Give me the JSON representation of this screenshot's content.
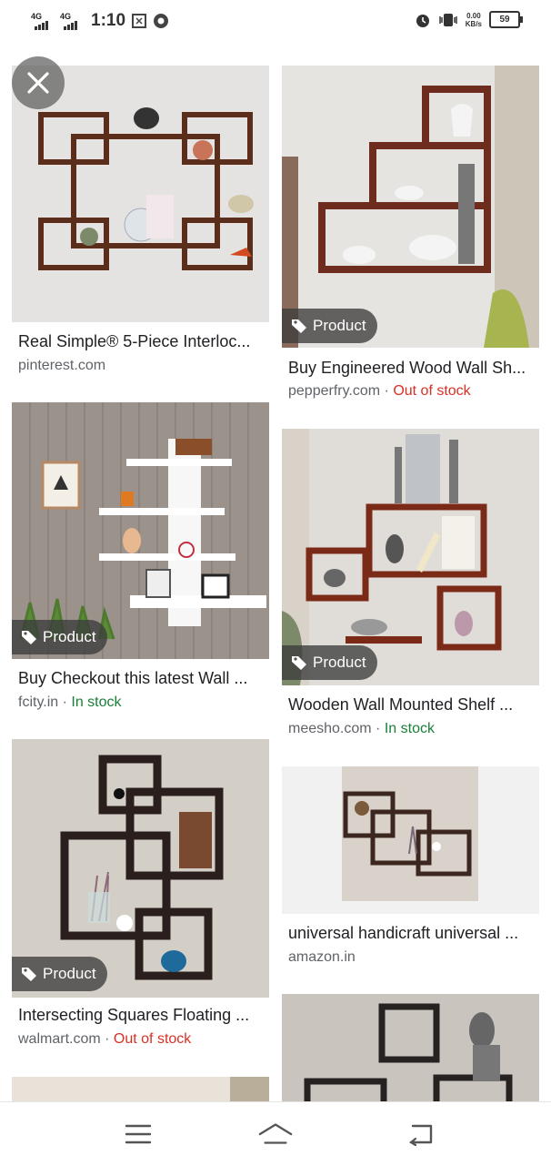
{
  "status_bar": {
    "network1": "4G",
    "network2": "4G",
    "time": "1:10",
    "speed_value": "0.00",
    "speed_unit": "KB/s",
    "battery": "59"
  },
  "close_icon": "close-icon",
  "results": [
    {
      "title": "Real Simple® 5-Piece Interloc...",
      "source": "pinterest.com",
      "status": "",
      "badge": ""
    },
    {
      "title": "Buy Engineered Wood Wall Sh...",
      "source": "pepperfry.com",
      "status": "Out of stock",
      "badge": "Product"
    },
    {
      "title": "Buy Checkout this latest Wall ...",
      "source": "fcity.in",
      "status": "In stock",
      "badge": "Product"
    },
    {
      "title": "Wooden Wall Mounted Shelf ...",
      "source": "meesho.com",
      "status": "In stock",
      "badge": "Product"
    },
    {
      "title": "Intersecting Squares Floating ...",
      "source": "walmart.com",
      "status": "Out of stock",
      "badge": "Product"
    },
    {
      "title": "universal handicraft universal ...",
      "source": "amazon.in",
      "status": "",
      "badge": ""
    }
  ],
  "separator": "·",
  "colors": {
    "out_of_stock": "#d93025",
    "in_stock": "#188038",
    "badge_bg": "#3c3c3c"
  },
  "bottom_nav": {
    "menu_icon": "menu-icon",
    "home_icon": "home-icon",
    "back_icon": "back-icon"
  }
}
